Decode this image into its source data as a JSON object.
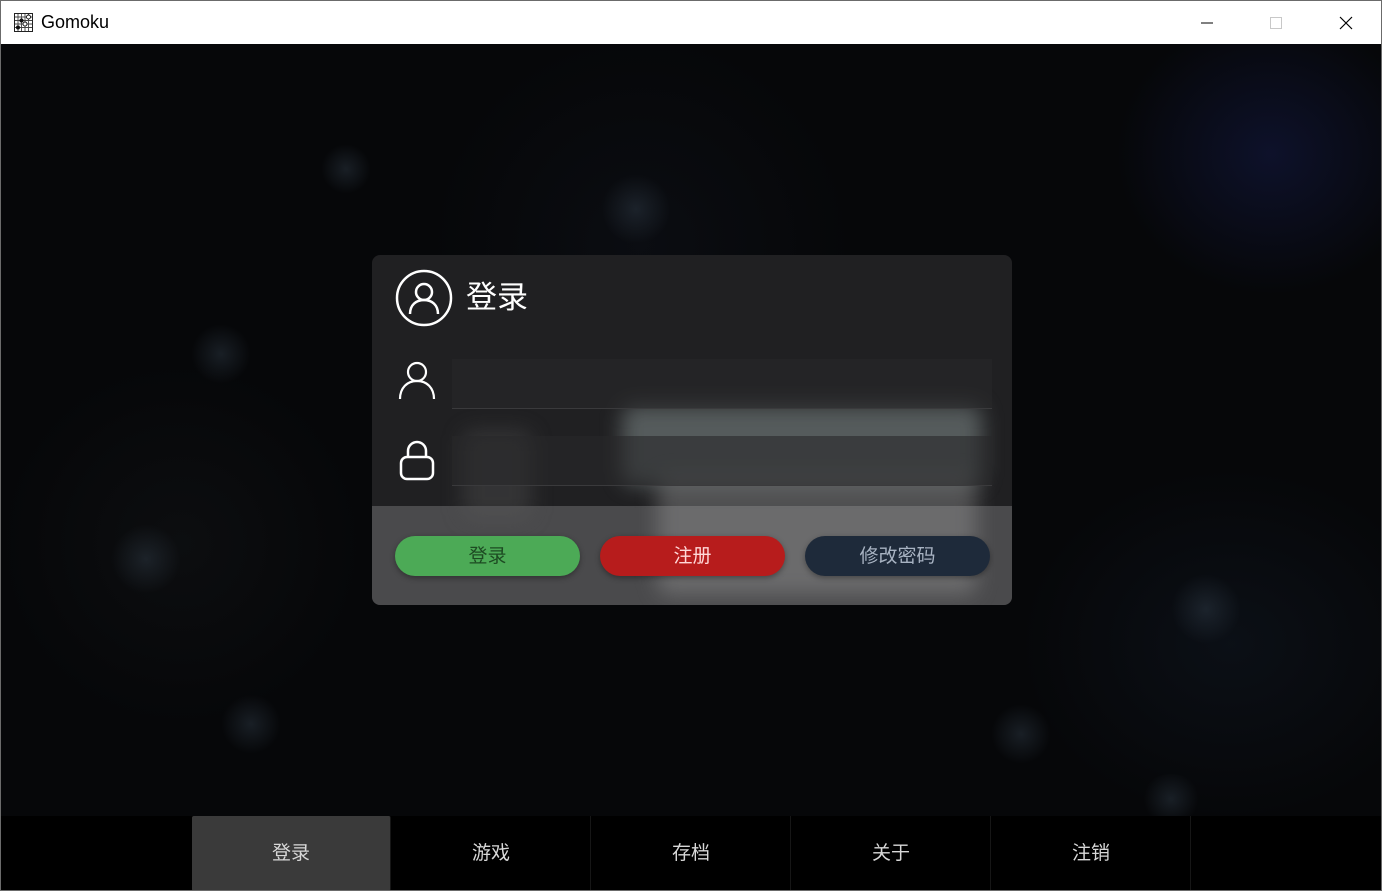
{
  "window": {
    "title": "Gomoku",
    "icons": {
      "app": "gomoku-board-icon",
      "minimize": "minimize-icon",
      "maximize": "maximize-icon",
      "close": "close-icon"
    }
  },
  "login_card": {
    "title": "登录",
    "header_icon": "user-circle-icon",
    "username": {
      "icon": "user-icon",
      "value": "",
      "placeholder": ""
    },
    "password": {
      "icon": "lock-icon",
      "value": "",
      "placeholder": ""
    },
    "buttons": {
      "login": "登录",
      "register": "注册",
      "change_password": "修改密码"
    },
    "colors": {
      "login": "#4caa56",
      "register": "#b71c1c",
      "change_password": "#1e2a3a"
    }
  },
  "bottom_nav": {
    "items": [
      {
        "label": "登录",
        "active": true
      },
      {
        "label": "游戏",
        "active": false
      },
      {
        "label": "存档",
        "active": false
      },
      {
        "label": "关于",
        "active": false
      },
      {
        "label": "注销",
        "active": false
      }
    ]
  }
}
